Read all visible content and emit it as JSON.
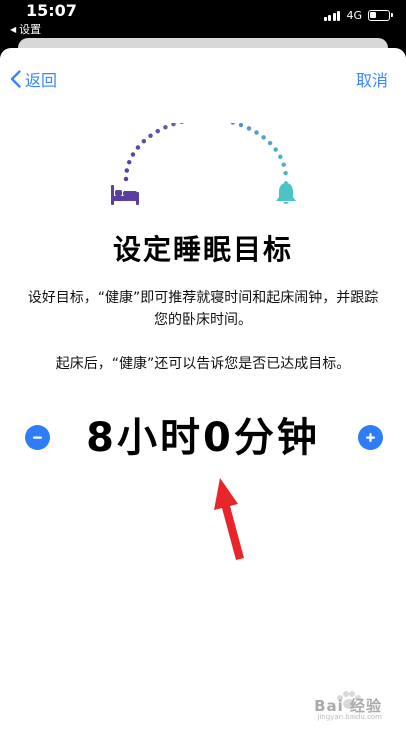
{
  "status_bar": {
    "time": "15:07",
    "back_app": "设置",
    "network": "4G"
  },
  "nav": {
    "back_label": "返回",
    "cancel_label": "取消"
  },
  "main": {
    "title": "设定睡眠目标",
    "description": "设好目标，“健康”即可推荐就寝时间和起床闹钟，并跟踪您的卧床时间。",
    "description2": "起床后，“健康”还可以告诉您是否已达成目标。",
    "duration": "8小时0分钟"
  },
  "icons": {
    "bed": "bed-icon",
    "alarm": "bell-icon",
    "minus": "minus-icon",
    "plus": "plus-icon"
  },
  "colors": {
    "accent": "#2f7df6",
    "bed_purple": "#5b3fa0",
    "bell_teal": "#4cc3c7",
    "annotation_red": "#e8262a"
  },
  "watermark": {
    "brand": "Bai 经验",
    "url": "jingyan.baidu.com"
  }
}
